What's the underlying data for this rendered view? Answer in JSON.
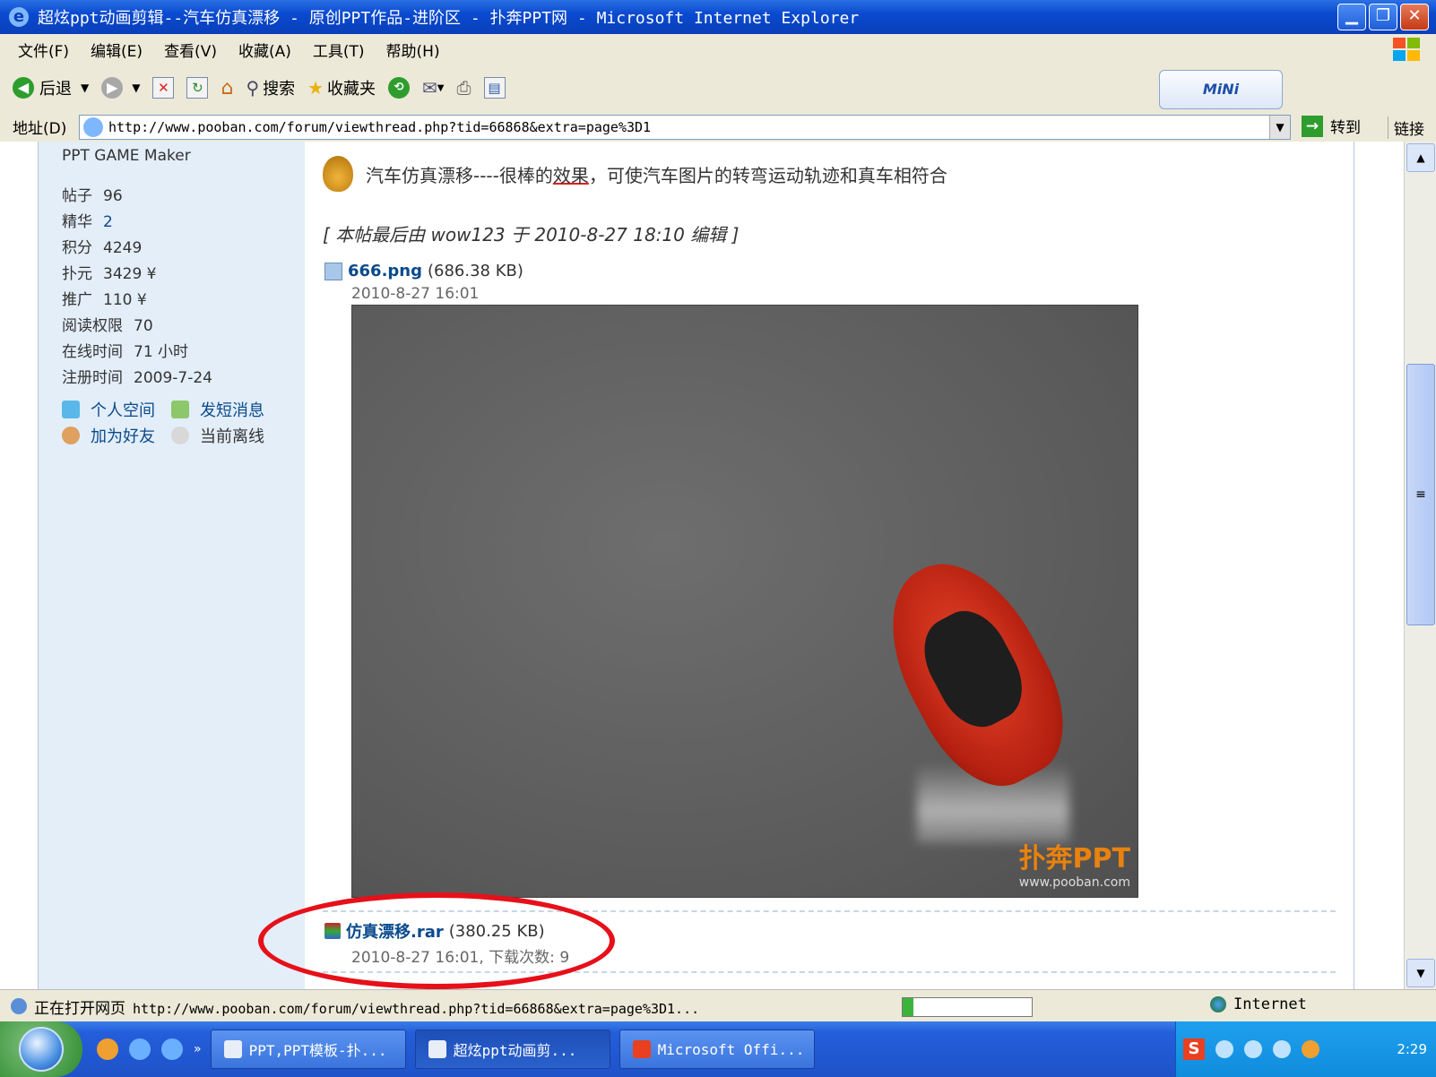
{
  "window": {
    "title": "超炫ppt动画剪辑--汽车仿真漂移 - 原创PPT作品-进阶区 - 扑奔PPT网 - Microsoft Internet Explorer",
    "minimize": "▁",
    "maximize": "❐",
    "close": "✕"
  },
  "menu": [
    "文件(F)",
    "编辑(E)",
    "查看(V)",
    "收藏(A)",
    "工具(T)",
    "帮助(H)"
  ],
  "toolbar": {
    "back": "后退",
    "search": "搜索",
    "favorites": "收藏夹",
    "mini": "MiNi"
  },
  "address": {
    "label": "地址(D)",
    "url": "http://www.pooban.com/forum/viewthread.php?tid=66868&extra=page%3D1",
    "go": "转到",
    "links": "链接"
  },
  "profile": {
    "name": "PPT GAME Maker",
    "stats": [
      {
        "k": "帖子",
        "v": "96"
      },
      {
        "k": "精华",
        "v": "2"
      },
      {
        "k": "积分",
        "v": "4249"
      },
      {
        "k": "扑元",
        "v": "3429 ¥"
      },
      {
        "k": "推广",
        "v": "110 ¥"
      },
      {
        "k": "阅读权限",
        "v": "70"
      },
      {
        "k": "在线时间",
        "v": "71 小时"
      },
      {
        "k": "注册时间",
        "v": "2009-7-24"
      }
    ],
    "actions": {
      "space": "个人空间",
      "pm": "发短消息",
      "add_friend": "加为好友",
      "status": "当前离线"
    }
  },
  "post": {
    "text_before": "汽车仿真漂移----很棒的",
    "text_underlined": "效果",
    "text_after": "，可使汽车图片的转弯运动轨迹和真车相符合",
    "edited": "[ 本帖最后由 wow123 于 2010-8-27 18:10 编辑 ]",
    "attachment1": {
      "name": "666.png",
      "size": "(686.38 KB)",
      "date": "2010-8-27 16:01"
    },
    "watermark": {
      "brand": "扑奔PPT",
      "site": "www.pooban.com"
    },
    "attachment2": {
      "name": "仿真漂移.rar",
      "size": "(380.25 KB)",
      "date": "2010-8-27 16:01, 下载次数: 9"
    }
  },
  "status": {
    "text": "正在打开网页",
    "url": "http://www.pooban.com/forum/viewthread.php?tid=66868&extra=page%3D1...",
    "zone": "Internet",
    "progress": 0.08
  },
  "taskbar": {
    "tasks": [
      "PPT,PPT模板-扑...",
      "超炫ppt动画剪...",
      "Microsoft Offi..."
    ],
    "tray_s": "S",
    "clock": "2:29"
  }
}
